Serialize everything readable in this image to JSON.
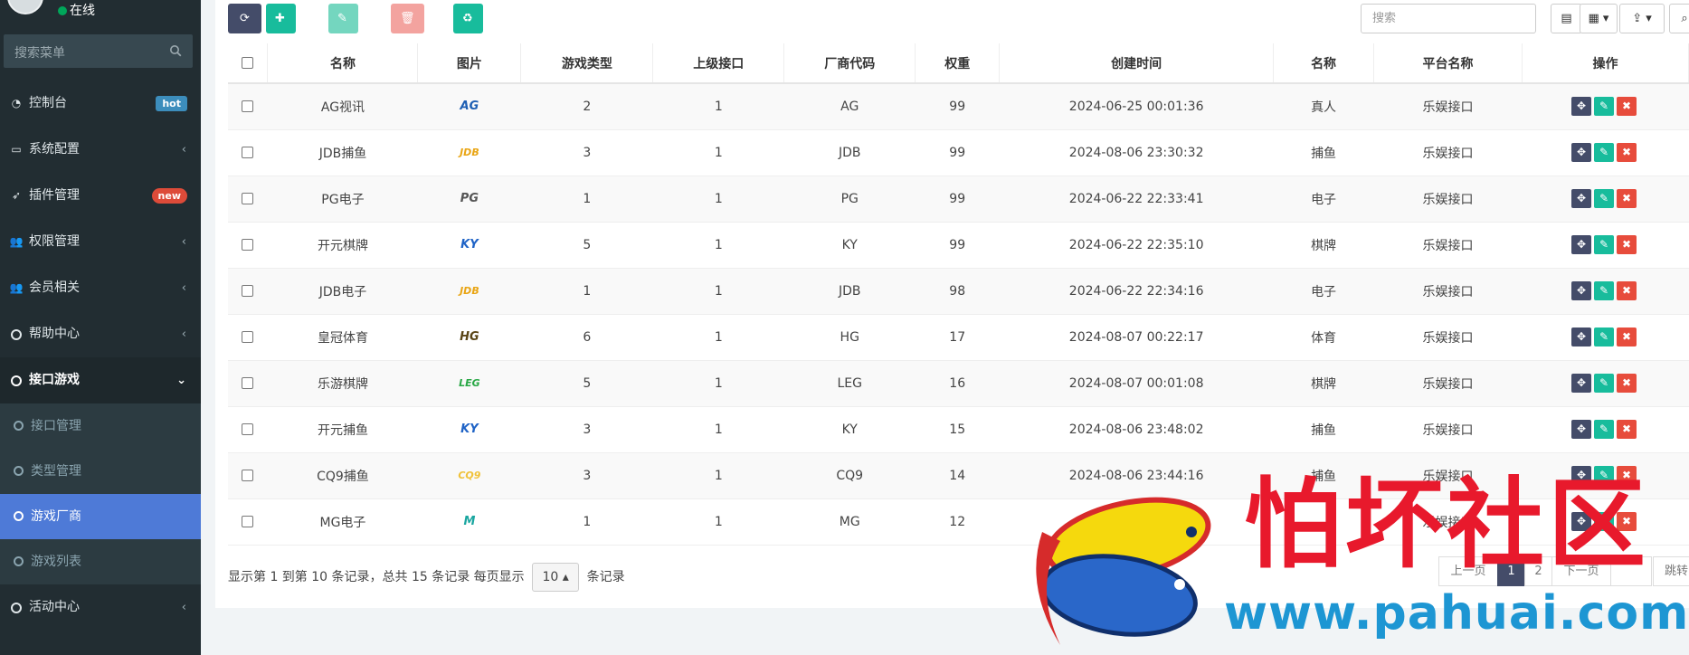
{
  "sidebar": {
    "status": "在线",
    "search_placeholder": "搜索菜单",
    "menu": [
      {
        "label": "控制台",
        "badge": "hot"
      },
      {
        "label": "系统配置"
      },
      {
        "label": "插件管理",
        "badge": "new"
      },
      {
        "label": "权限管理"
      },
      {
        "label": "会员相关"
      },
      {
        "label": "帮助中心"
      },
      {
        "label": "接口游戏"
      }
    ],
    "submenu": [
      "接口管理",
      "类型管理",
      "游戏厂商",
      "游戏列表"
    ],
    "after": [
      {
        "label": "活动中心"
      }
    ]
  },
  "toolbar": {
    "add": "添加",
    "edit": "编辑",
    "delete": "删除",
    "recycle": "回收站",
    "search_placeholder": "搜索"
  },
  "table": {
    "headers": [
      "名称",
      "图片",
      "游戏类型",
      "上级接口",
      "厂商代码",
      "权重",
      "创建时间",
      "名称",
      "平台名称",
      "操作"
    ],
    "rows": [
      {
        "name": "AG视讯",
        "logo": "AG",
        "logo_color": "#1e5fb3",
        "type": "2",
        "parent": "1",
        "code": "AG",
        "weight": "99",
        "created": "2024-06-25 00:01:36",
        "cat": "真人",
        "platform": "乐娱接口"
      },
      {
        "name": "JDB捕鱼",
        "logo": "JDB",
        "logo_color": "#e9a514",
        "type": "3",
        "parent": "1",
        "code": "JDB",
        "weight": "99",
        "created": "2024-08-06 23:30:32",
        "cat": "捕鱼",
        "platform": "乐娱接口"
      },
      {
        "name": "PG电子",
        "logo": "PG",
        "logo_color": "#555555",
        "type": "1",
        "parent": "1",
        "code": "PG",
        "weight": "99",
        "created": "2024-06-22 22:33:41",
        "cat": "电子",
        "platform": "乐娱接口"
      },
      {
        "name": "开元棋牌",
        "logo": "KY",
        "logo_color": "#1f63c6",
        "type": "5",
        "parent": "1",
        "code": "KY",
        "weight": "99",
        "created": "2024-06-22 22:35:10",
        "cat": "棋牌",
        "platform": "乐娱接口"
      },
      {
        "name": "JDB电子",
        "logo": "JDB",
        "logo_color": "#e9a514",
        "type": "1",
        "parent": "1",
        "code": "JDB",
        "weight": "98",
        "created": "2024-06-22 22:34:16",
        "cat": "电子",
        "platform": "乐娱接口"
      },
      {
        "name": "皇冠体育",
        "logo": "HG",
        "logo_color": "#5a4516",
        "type": "6",
        "parent": "1",
        "code": "HG",
        "weight": "17",
        "created": "2024-08-07 00:22:17",
        "cat": "体育",
        "platform": "乐娱接口"
      },
      {
        "name": "乐游棋牌",
        "logo": "LEG",
        "logo_color": "#27a744",
        "type": "5",
        "parent": "1",
        "code": "LEG",
        "weight": "16",
        "created": "2024-08-07 00:01:08",
        "cat": "棋牌",
        "platform": "乐娱接口"
      },
      {
        "name": "开元捕鱼",
        "logo": "KY",
        "logo_color": "#1f63c6",
        "type": "3",
        "parent": "1",
        "code": "KY",
        "weight": "15",
        "created": "2024-08-06 23:48:02",
        "cat": "捕鱼",
        "platform": "乐娱接口"
      },
      {
        "name": "CQ9捕鱼",
        "logo": "CQ9",
        "logo_color": "#f0c23a",
        "type": "3",
        "parent": "1",
        "code": "CQ9",
        "weight": "14",
        "created": "2024-08-06 23:44:16",
        "cat": "捕鱼",
        "platform": "乐娱接口"
      },
      {
        "name": "MG电子",
        "logo": "M",
        "logo_color": "#1aa6a0",
        "type": "1",
        "parent": "1",
        "code": "MG",
        "weight": "12",
        "created": "",
        "cat": "",
        "platform": "乐娱接口"
      }
    ]
  },
  "pager": {
    "summary": "显示第 1 到第 10 条记录，总共 15 条记录 每页显示",
    "page_size": "10",
    "suffix": "条记录",
    "prev": "上一页",
    "p1": "1",
    "p2": "2",
    "next": "下一页",
    "jump": "跳转"
  },
  "watermark": {
    "title": "怕坏社区",
    "url": "www.pahuai.com"
  }
}
